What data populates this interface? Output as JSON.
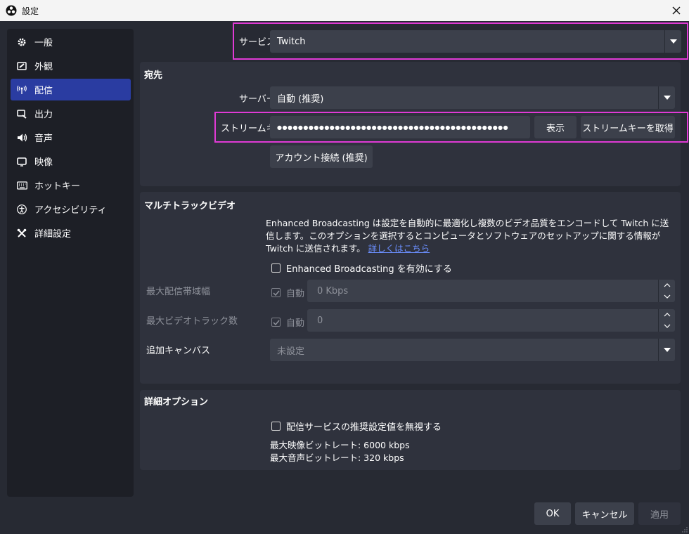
{
  "window": {
    "title": "設定"
  },
  "sidebar": {
    "items": [
      {
        "label": "一般",
        "icon": "gear-icon"
      },
      {
        "label": "外観",
        "icon": "appearance-icon"
      },
      {
        "label": "配信",
        "icon": "broadcast-icon",
        "active": true
      },
      {
        "label": "出力",
        "icon": "output-icon"
      },
      {
        "label": "音声",
        "icon": "speaker-icon"
      },
      {
        "label": "映像",
        "icon": "monitor-icon"
      },
      {
        "label": "ホットキー",
        "icon": "keyboard-icon"
      },
      {
        "label": "アクセシビリティ",
        "icon": "accessibility-icon"
      },
      {
        "label": "詳細設定",
        "icon": "tools-icon"
      }
    ]
  },
  "service": {
    "label": "サービス",
    "value": "Twitch"
  },
  "destination": {
    "title": "宛先",
    "server_label": "サーバー",
    "server_value": "自動 (推奨)",
    "stream_key_label": "ストリームキー",
    "stream_key_value": "●●●●●●●●●●●●●●●●●●●●●●●●●●●●●●●●●●●●●●●●●●●●",
    "show_button": "表示",
    "get_key_button": "ストリームキーを取得",
    "connect_account_button": "アカウント接続 (推奨)"
  },
  "multitrack": {
    "title": "マルチトラックビデオ",
    "description": "Enhanced Broadcasting は設定を自動的に最適化し複数のビデオ品質をエンコードして Twitch に送信します。このオプションを選択するとコンピュータとソフトウェアのセットアップに関する情報が Twitch に送信されます。",
    "learn_more": "詳しくはこちら",
    "enable_label": "Enhanced Broadcasting を有効にする",
    "max_bandwidth_label": "最大配信帯域幅",
    "max_bandwidth_auto": "自動",
    "max_bandwidth_value": "0 Kbps",
    "max_tracks_label": "最大ビデオトラック数",
    "max_tracks_auto": "自動",
    "max_tracks_value": "0",
    "extra_canvas_label": "追加キャンバス",
    "extra_canvas_value": "未設定"
  },
  "advanced": {
    "title": "詳細オプション",
    "ignore_label": "配信サービスの推奨設定値を無視する",
    "max_video_bitrate": "最大映像ビットレート: 6000 kbps",
    "max_audio_bitrate": "最大音声ビットレート: 320 kbps"
  },
  "dialog_buttons": {
    "ok": "OK",
    "cancel": "キャンセル",
    "apply": "適用"
  },
  "colors": {
    "accent": "#2a3ca1",
    "highlight": "#e03ad5",
    "background": "#272a33"
  }
}
